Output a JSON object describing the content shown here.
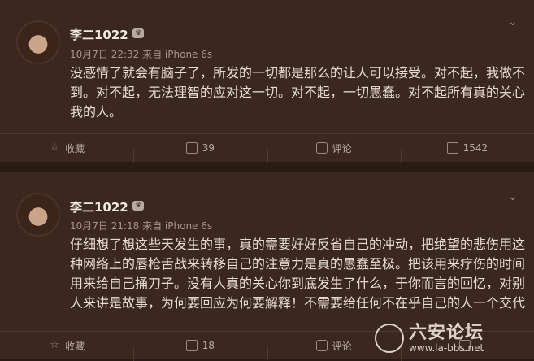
{
  "posts": [
    {
      "author": "李二1022",
      "badge": "♛",
      "meta": "10月7日 22:32 来自 iPhone 6s",
      "text": "没感情了就会有脑子了，所发的一切都是那么的让人可以接受。对不起，我做不到。对不起，无法理智的应对这一切。对不起，一切愚蠢。对不起所有真的关心我的人。",
      "actions": {
        "favorite": "收藏",
        "share": "39",
        "comment": "评论",
        "like": "1542"
      }
    },
    {
      "author": "李二1022",
      "badge": "♛",
      "meta": "10月7日 21:18 来自 iPhone 6s",
      "text": "仔细想了想这些天发生的事，真的需要好好反省自己的冲动，把绝望的悲伤用这种网络上的唇枪舌战来转移自己的注意力是真的愚蠢至极。把该用来疗伤的时间用来给自己捅刀子。没有人真的关心你到底发生了什么，于你而言的回忆，对别人来讲是故事，为何要回应为何要解释！不需要给任何不在乎自己的人一个交代",
      "actions": {
        "favorite": "收藏",
        "share": "18",
        "comment": "评论"
      }
    }
  ],
  "watermark": {
    "main": "六安论坛",
    "url": "www.la-bbs.net"
  },
  "colors": {
    "background": "#2a1a14",
    "card": "#3a2820",
    "text": "#e6dcd2",
    "muted": "#a79589"
  },
  "icons": {
    "chevron": "chevron-down-icon",
    "favorite": "star-icon",
    "share": "share-icon",
    "comment": "comment-icon",
    "like": "thumbs-up-icon"
  }
}
